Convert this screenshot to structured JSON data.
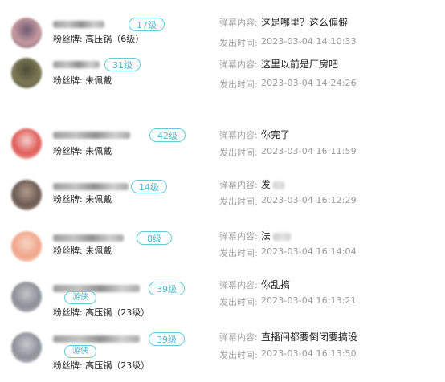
{
  "labels": {
    "content": "弹幕内容:",
    "time": "发出时间:"
  },
  "colors": {
    "badge_border": "#64c9d9",
    "badge_text": "#4fb7c9"
  },
  "entries": [
    {
      "level": "17级",
      "special_badge": "",
      "fan_badge": "粉丝牌:  高压锅（6级）",
      "content": "这是哪里？这么偏僻",
      "time": "2023-03-04 14:10:33",
      "content_obscured": false,
      "avatar_colors": [
        "#c79aa0",
        "#6d5a73"
      ]
    },
    {
      "level": "31级",
      "special_badge": "",
      "fan_badge": "粉丝牌:  未佩戴",
      "content": "这里以前是厂房吧",
      "time": "2023-03-04 14:24:26",
      "content_obscured": false,
      "avatar_colors": [
        "#7c7a55",
        "#4d4b38"
      ]
    },
    {
      "level": "42级",
      "special_badge": "",
      "fan_badge": "粉丝牌:  未佩戴",
      "content": "你完了",
      "time": "2023-03-04 16:11:59",
      "content_obscured": false,
      "avatar_colors": [
        "#e05a55",
        "#f3d0cf"
      ]
    },
    {
      "level": "14级",
      "special_badge": "",
      "fan_badge": "粉丝牌:  未佩戴",
      "content": "发",
      "time": "2023-03-04 16:12:29",
      "content_obscured": true,
      "avatar_colors": [
        "#6b5b55",
        "#b39b8c"
      ]
    },
    {
      "level": "8级",
      "special_badge": "",
      "fan_badge": "粉丝牌:  未佩戴",
      "content": "法",
      "time": "2023-03-04 16:14:04",
      "content_obscured": true,
      "avatar_colors": [
        "#f0a58a",
        "#f7d5c4"
      ]
    },
    {
      "level": "39级",
      "special_badge": "游侠",
      "fan_badge": "粉丝牌:  高压锅（23级）",
      "content": "你乱搞",
      "time": "2023-03-04 16:13:21",
      "content_obscured": false,
      "avatar_colors": [
        "#8d8f96",
        "#c4c5ca"
      ]
    },
    {
      "level": "39级",
      "special_badge": "游侠",
      "fan_badge": "粉丝牌:  高压锅（23级）",
      "content": "直播间都要倒闭要搞没",
      "time": "2023-03-04 16:13:50",
      "content_obscured": false,
      "avatar_colors": [
        "#8e9098",
        "#c8c9ce"
      ]
    }
  ]
}
